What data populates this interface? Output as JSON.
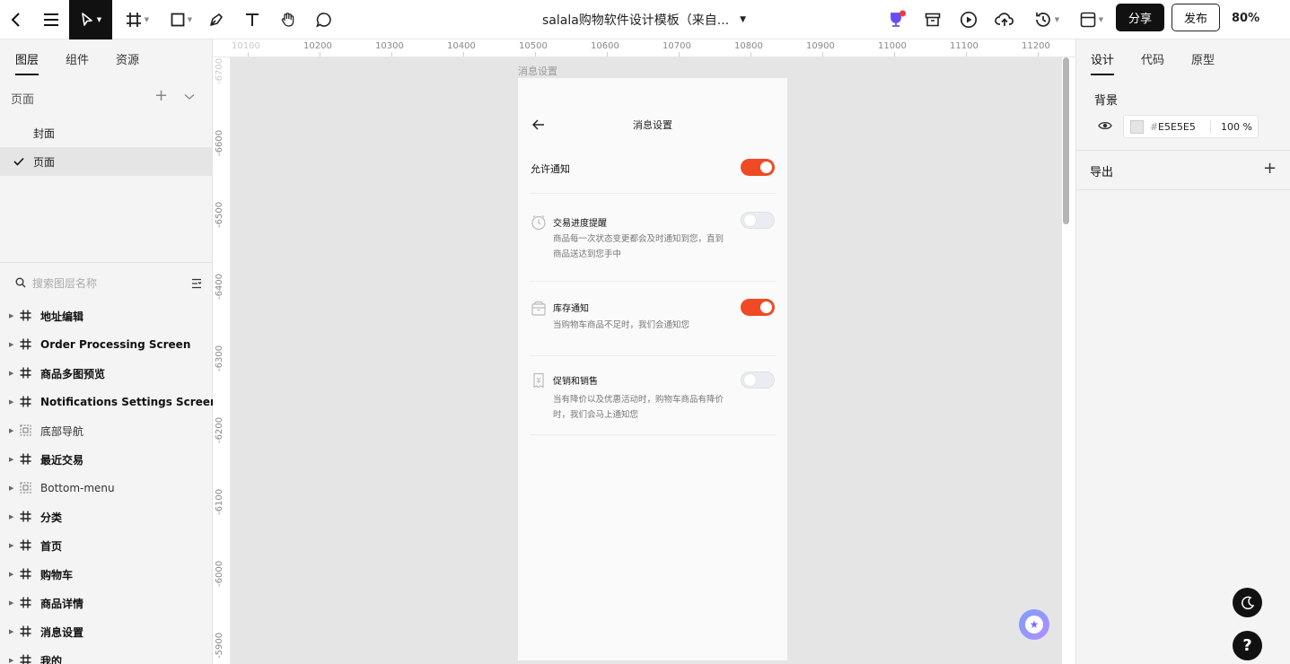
{
  "toolbar": {
    "document_title": "salala购物软件设计模板（来自...",
    "share_label": "分享",
    "publish_label": "发布",
    "zoom": "80%"
  },
  "left_panel": {
    "tabs": [
      "图层",
      "组件",
      "资源"
    ],
    "pages_header": "页面",
    "pages": [
      {
        "label": "封面",
        "selected": false
      },
      {
        "label": "页面",
        "selected": true
      }
    ],
    "search_placeholder": "搜索图层名称",
    "layers": [
      {
        "name": "地址编辑",
        "icon": "frame-icon",
        "bold": true
      },
      {
        "name": "Order Processing Screen",
        "icon": "frame-icon",
        "bold": true
      },
      {
        "name": "商品多图预览",
        "icon": "frame-icon",
        "bold": true
      },
      {
        "name": "Notifications Settings Screen",
        "icon": "frame-icon",
        "bold": true
      },
      {
        "name": "底部导航",
        "icon": "component-icon",
        "bold": false
      },
      {
        "name": "最近交易",
        "icon": "frame-icon",
        "bold": true
      },
      {
        "name": "Bottom-menu",
        "icon": "component-icon",
        "bold": false
      },
      {
        "name": "分类",
        "icon": "frame-icon",
        "bold": true
      },
      {
        "name": "首页",
        "icon": "frame-icon",
        "bold": true
      },
      {
        "name": "购物车",
        "icon": "frame-icon",
        "bold": true
      },
      {
        "name": "商品详情",
        "icon": "frame-icon",
        "bold": true
      },
      {
        "name": "消息设置",
        "icon": "frame-icon",
        "bold": true
      },
      {
        "name": "我的",
        "icon": "frame-icon",
        "bold": true
      }
    ]
  },
  "rulers": {
    "top": [
      "10100",
      "10200",
      "10300",
      "10400",
      "10500",
      "10600",
      "10700",
      "10800",
      "10900",
      "11000",
      "11100",
      "11200"
    ],
    "left": [
      "-6700",
      "-6600",
      "-6500",
      "-6400",
      "-6300",
      "-6200",
      "-6100",
      "-6000",
      "-5900"
    ]
  },
  "canvas": {
    "frame_label": "消息设置",
    "background": "#E5E5E5"
  },
  "phone": {
    "title": "消息设置",
    "allow_label": "允许通知",
    "allow_on": true,
    "items": [
      {
        "icon": "clock-icon",
        "title": "交易进度提醒",
        "desc": "商品每一次状态变更都会及时通知到您，直到商品送达到您手中",
        "on": false
      },
      {
        "icon": "box-icon",
        "title": "库存通知",
        "desc": "当购物车商品不足时，我们会通知您",
        "on": true
      },
      {
        "icon": "tag-icon",
        "title": "促销和销售",
        "desc": "当有降价以及优惠活动时，购物车商品有降价时，我们会马上通知您",
        "on": false
      }
    ],
    "accent_color": "#F04A24"
  },
  "right_panel": {
    "tabs": [
      "设计",
      "代码",
      "原型"
    ],
    "background_title": "背景",
    "background_hex": "E5E5E5",
    "background_opacity": "100",
    "opacity_unit": "%",
    "export_title": "导出"
  }
}
